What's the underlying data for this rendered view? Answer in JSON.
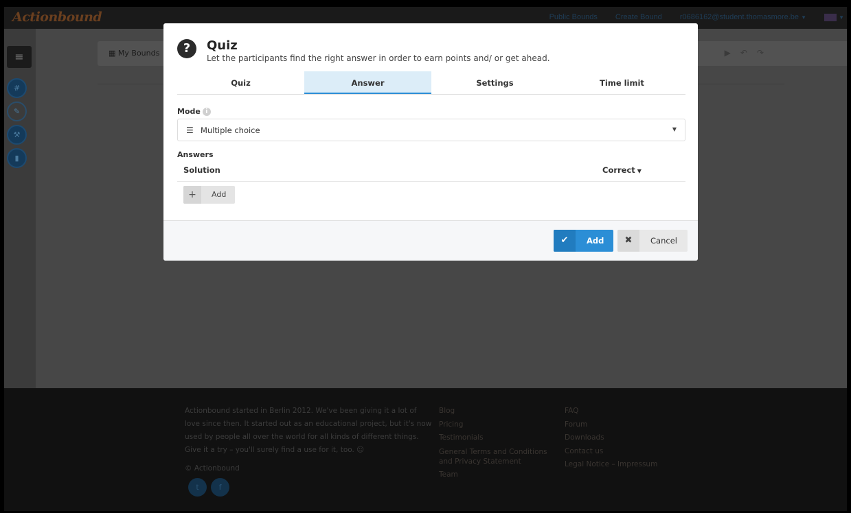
{
  "app": {
    "logo": "Actionbound"
  },
  "topnav": {
    "public_bounds": "Public Bounds",
    "create_bound": "Create Bound",
    "user_email": "r0686162@student.thomasmore.be",
    "language_flag": "uk-flag-icon"
  },
  "workbar": {
    "my_bounds": "My Bounds"
  },
  "modal": {
    "title": "Quiz",
    "subtitle": "Let the participants find the right answer in order to earn points and/ or get ahead.",
    "tabs": [
      {
        "label": "Quiz",
        "active": false
      },
      {
        "label": "Answer",
        "active": true
      },
      {
        "label": "Settings",
        "active": false
      },
      {
        "label": "Time limit",
        "active": false
      }
    ],
    "mode_label": "Mode",
    "mode_value": "Multiple choice",
    "answers_label": "Answers",
    "solution_header": "Solution",
    "correct_header": "Correct",
    "add_row_label": "Add",
    "add_button": "Add",
    "cancel_button": "Cancel",
    "accent_color": "#2b8ed6"
  },
  "footer": {
    "about": "Actionbound started in Berlin 2012. We've been giving it a lot of love since then. It started out as an educational project, but it's now used by people all over the world for all kinds of different things. Give it a try – you'll surely find a use for it, too. ☺",
    "copyright": "© Actionbound",
    "links_col1": [
      "Blog",
      "Pricing",
      "Testimonials",
      "General Terms and Conditions and Privacy Statement",
      "Team"
    ],
    "links_col2": [
      "FAQ",
      "Forum",
      "Downloads",
      "Contact us",
      "Legal Notice – Impressum"
    ]
  }
}
